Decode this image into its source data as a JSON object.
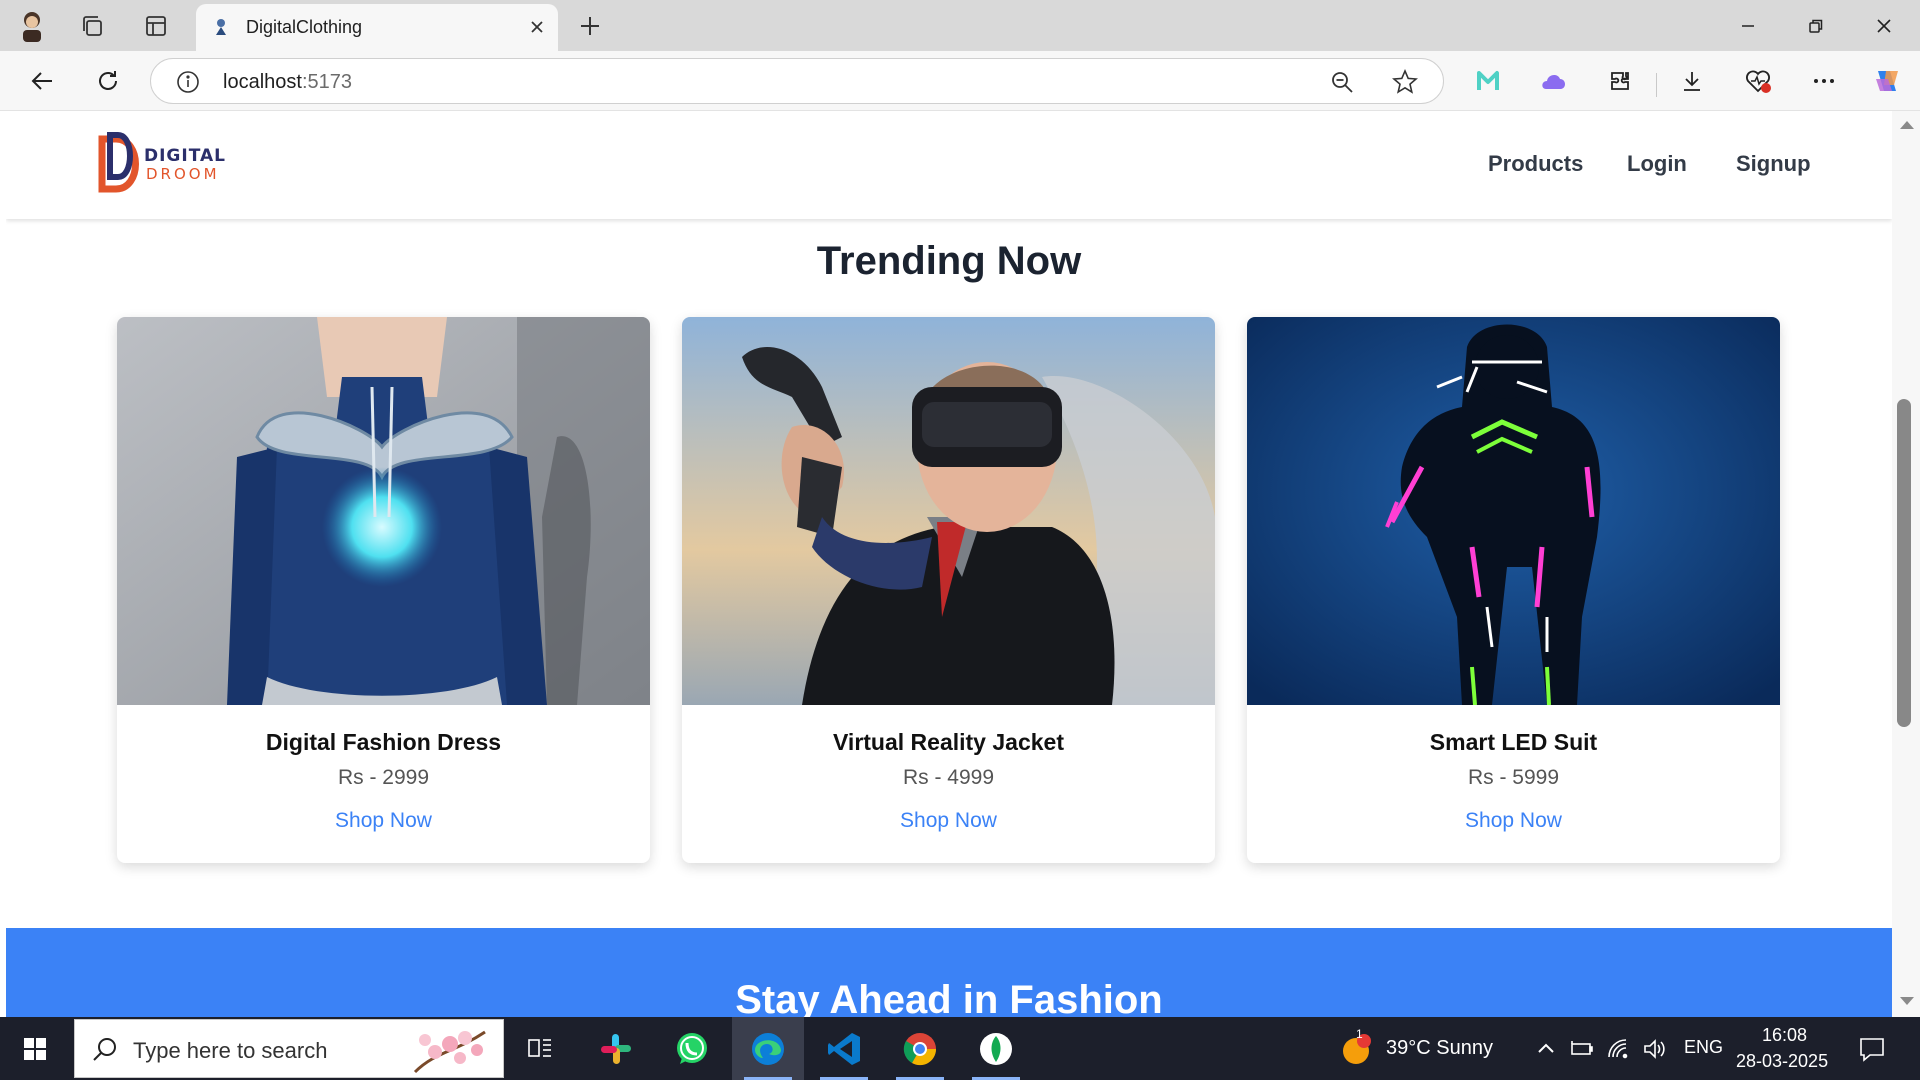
{
  "browser": {
    "tab_title": "DigitalClothing",
    "url_host": "localhost",
    "url_port": ":5173"
  },
  "site": {
    "logo_line1": "DIGITAL",
    "logo_line2": "DROOM",
    "nav": [
      "Products",
      "Login",
      "Signup"
    ]
  },
  "trending": {
    "title": "Trending Now",
    "products": [
      {
        "name": "Digital Fashion Dress",
        "price": "Rs - 2999",
        "cta": "Shop Now"
      },
      {
        "name": "Virtual Reality Jacket",
        "price": "Rs - 4999",
        "cta": "Shop Now"
      },
      {
        "name": "Smart LED Suit",
        "price": "Rs - 5999",
        "cta": "Shop Now"
      }
    ]
  },
  "banner": {
    "title": "Stay Ahead in Fashion"
  },
  "taskbar": {
    "search_placeholder": "Type here to search",
    "weather": "39°C  Sunny",
    "weather_badge": "1",
    "language": "ENG",
    "time": "16:08",
    "date": "28-03-2025"
  },
  "colors": {
    "accent": "#3b82f6",
    "logo_navy": "#2b2f6b",
    "logo_orange": "#e2552b",
    "taskbar": "#1c1f2b"
  },
  "icons": [
    "profile-avatar-icon",
    "workspaces-icon",
    "tab-actions-icon",
    "close-icon",
    "new-tab-icon",
    "minimize-icon",
    "restore-icon",
    "back-icon",
    "refresh-icon",
    "info-icon",
    "zoom-out-icon",
    "favorite-star-icon",
    "extension-m-icon",
    "extension-cloud-icon",
    "extensions-icon",
    "downloads-icon",
    "performance-icon",
    "more-icon",
    "copilot-icon",
    "windows-start-icon",
    "search-icon",
    "task-view-icon",
    "slack-icon",
    "whatsapp-icon",
    "edge-icon",
    "vscode-icon",
    "chrome-icon",
    "mongodb-icon",
    "weather-icon",
    "chevron-up-icon",
    "battery-icon",
    "wifi-icon",
    "volume-icon",
    "notifications-icon"
  ]
}
